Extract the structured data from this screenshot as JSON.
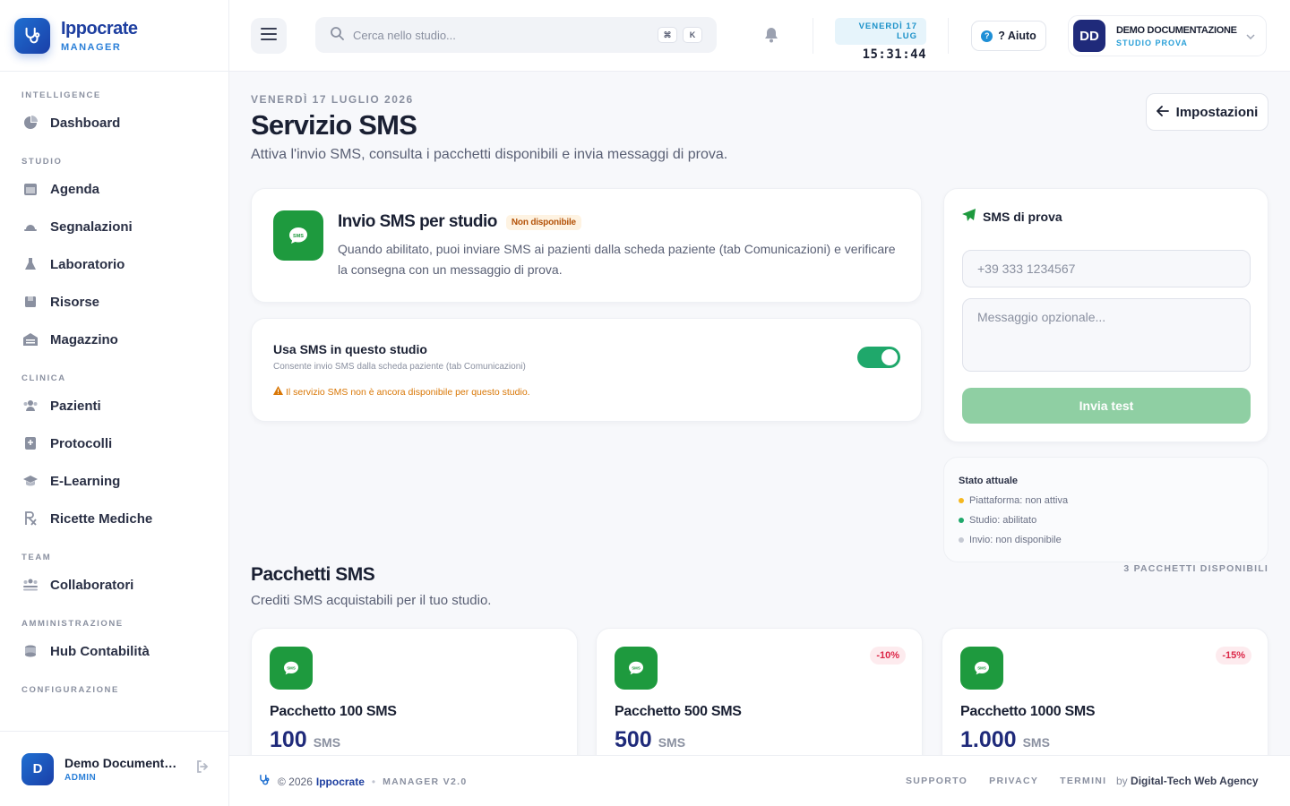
{
  "brand": {
    "name": "Ippocrate",
    "sub": "MANAGER"
  },
  "nav": {
    "sections": [
      {
        "label": "INTELLIGENCE",
        "items": [
          {
            "label": "Dashboard",
            "icon": "pie-chart-icon"
          }
        ]
      },
      {
        "label": "STUDIO",
        "items": [
          {
            "label": "Agenda",
            "icon": "calendar-icon"
          },
          {
            "label": "Segnalazioni",
            "icon": "bell-alert-icon"
          },
          {
            "label": "Laboratorio",
            "icon": "flask-icon"
          },
          {
            "label": "Risorse",
            "icon": "resource-icon"
          },
          {
            "label": "Magazzino",
            "icon": "warehouse-icon"
          }
        ]
      },
      {
        "label": "CLINICA",
        "items": [
          {
            "label": "Pazienti",
            "icon": "users-icon"
          },
          {
            "label": "Protocolli",
            "icon": "protocol-icon"
          },
          {
            "label": "E-Learning",
            "icon": "graduation-cap-icon"
          },
          {
            "label": "Ricette Mediche",
            "icon": "prescription-icon"
          }
        ]
      },
      {
        "label": "TEAM",
        "items": [
          {
            "label": "Collaboratori",
            "icon": "team-icon"
          }
        ]
      },
      {
        "label": "AMMINISTRAZIONE",
        "items": [
          {
            "label": "Hub Contabilità",
            "icon": "coins-icon"
          }
        ]
      },
      {
        "label": "CONFIGURAZIONE",
        "items": []
      }
    ]
  },
  "sidebar_user": {
    "initial": "D",
    "name": "Demo Documentazione",
    "role": "ADMIN"
  },
  "topbar": {
    "search_placeholder": "Cerca nello studio...",
    "kbd": [
      "⌘",
      "K"
    ],
    "date_chip": "VENERDÌ 17 LUG",
    "clock": "15:31:44",
    "help_label": "? Aiuto",
    "user": {
      "initials": "DD",
      "name": "DEMO DOCUMENTAZIONE",
      "studio": "STUDIO PROVA"
    }
  },
  "page": {
    "date": "VENERDÌ 17 LUGLIO 2026",
    "title": "Servizio SMS",
    "description": "Attiva l'invio SMS, consulta i pacchetti disponibili e invia messaggi di prova.",
    "settings_button": "Impostazioni"
  },
  "intro": {
    "title": "Invio SMS per studio",
    "badge": "Non disponibile",
    "text": "Quando abilitato, puoi inviare SMS ai pazienti dalla scheda paziente (tab Comunicazioni) e verificare la consegna con un messaggio di prova."
  },
  "toggle_card": {
    "title": "Usa SMS in questo studio",
    "subtitle": "Consente invio SMS dalla scheda paziente (tab Comunicazioni)",
    "warning": "Il servizio SMS non è ancora disponibile per questo studio.",
    "enabled": true
  },
  "test_card": {
    "title": "SMS di prova",
    "phone_placeholder": "+39 333 1234567",
    "message_placeholder": "Messaggio opzionale...",
    "button": "Invia test"
  },
  "state": {
    "title": "Stato attuale",
    "rows": [
      {
        "text": "Piattaforma: non attiva",
        "color": "#f5b820"
      },
      {
        "text": "Studio: abilitato",
        "color": "#1fa86b"
      },
      {
        "text": "Invio: non disponibile",
        "color": "#c5c9d3"
      }
    ]
  },
  "packages": {
    "title": "Pacchetti SMS",
    "description": "Crediti SMS acquistabili per il tuo studio.",
    "count_label": "3 PACCHETTI DISPONIBILI",
    "items": [
      {
        "name": "Pacchetto 100 SMS",
        "qty": "100",
        "unit": "SMS",
        "discount": ""
      },
      {
        "name": "Pacchetto 500 SMS",
        "qty": "500",
        "unit": "SMS",
        "discount": "-10%"
      },
      {
        "name": "Pacchetto 1000 SMS",
        "qty": "1.000",
        "unit": "SMS",
        "discount": "-15%"
      }
    ]
  },
  "footer": {
    "copyright": "© 2026",
    "brand": "Ippocrate",
    "version": "MANAGER V2.0",
    "links": [
      "SUPPORTO",
      "PRIVACY",
      "TERMINI"
    ],
    "by_prefix": "by",
    "by_name": "Digital-Tech Web Agency"
  },
  "colors": {
    "accent": "#1e3fa0",
    "sms_green": "#1e9a3e",
    "toggle_on": "#1fa86b",
    "warning": "#d97706",
    "discount": "#dc2647"
  }
}
